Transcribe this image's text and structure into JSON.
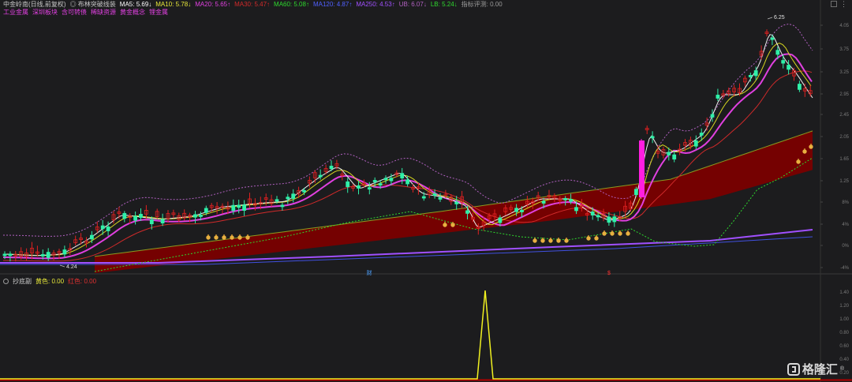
{
  "header": {
    "items": [
      {
        "text": "中金岭南(日线,前复权)",
        "color": "#c8c8c8"
      },
      {
        "text": "◎ 布林突破线装",
        "color": "#c8c8c8"
      },
      {
        "text": "MA5: 5.69↓",
        "color": "#ffffff"
      },
      {
        "text": "MA10: 5.78↓",
        "color": "#e8e83a"
      },
      {
        "text": "MA20: 5.65↑",
        "color": "#e040e0"
      },
      {
        "text": "MA30: 5.47↑",
        "color": "#d02a2a"
      },
      {
        "text": "MA60: 5.08↑",
        "color": "#2ed82e"
      },
      {
        "text": "MA120: 4.87↑",
        "color": "#5060ff"
      },
      {
        "text": "MA250: 4.53↑",
        "color": "#a050ff"
      },
      {
        "text": "UB: 6.07↓",
        "color": "#b060c0"
      },
      {
        "text": "LB: 5.24↓",
        "color": "#2ed82e"
      },
      {
        "text": "指标评测: 0.00",
        "color": "#9a9a9a"
      }
    ],
    "tags": [
      "工业金属",
      "深圳板块",
      "含可转债",
      "稀缺资源",
      "黄金概念",
      "锂金属"
    ],
    "tag_color": "#e040e0"
  },
  "indicator_header": {
    "name": "抄底副",
    "items": [
      {
        "text": "黄色: 0.00",
        "color": "#e8e83a"
      },
      {
        "text": "红色: 0.00",
        "color": "#e03030"
      }
    ]
  },
  "price_axis": [
    "4.05",
    "3.75",
    "3.25",
    "2.95",
    "2.45",
    "2.05",
    "1.65",
    "1.25",
    "8%",
    "4%",
    "0%",
    "-4%"
  ],
  "indicator_axis": [
    "1.40",
    "1.20",
    "1.00",
    "0.80",
    "0.60",
    "0.40",
    "0.20"
  ],
  "annotations": {
    "high_label": "6.25",
    "low_label": "4.24"
  },
  "markers": {
    "left": "财",
    "right": "$"
  },
  "chart_data": {
    "type": "candlestick",
    "symbol": "中金岭南",
    "period": "日线,前复权",
    "high": 6.25,
    "low": 4.24,
    "indicator_peak": 1.45
  },
  "watermark": {
    "text": "格隆汇",
    "reg": "®"
  },
  "colors": {
    "up": "#2ff0a8",
    "down": "#e02020",
    "pink_bar": "#ff1ee0",
    "band_fill": "#7a0000",
    "axis_text": "#7a7a7a",
    "grid": "#303030"
  }
}
